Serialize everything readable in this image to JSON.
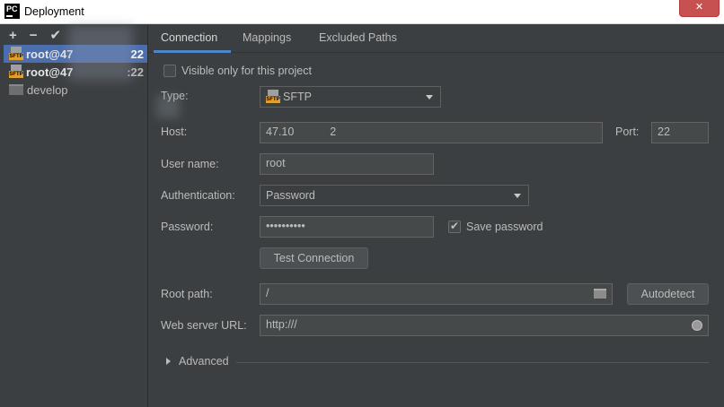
{
  "window": {
    "title": "Deployment",
    "close_label": "✕"
  },
  "left": {
    "toolbar": {
      "add": "+",
      "remove": "−",
      "apply": "✔"
    },
    "servers": [
      {
        "label": "root@47",
        "port_suffix": "22",
        "icon_tag": "SFTP",
        "selected": true
      },
      {
        "label": "root@47",
        "port_suffix": ":22",
        "icon_tag": "SFTP",
        "selected": false
      },
      {
        "label": "develop",
        "selected": false
      }
    ]
  },
  "tabs": [
    {
      "label": "Connection",
      "active": true
    },
    {
      "label": "Mappings",
      "active": false
    },
    {
      "label": "Excluded Paths",
      "active": false
    }
  ],
  "form": {
    "visible_only_label": "Visible only for this project",
    "visible_only_checked": false,
    "type": {
      "label": "Type:",
      "value": "SFTP",
      "icon_tag": "SFTP"
    },
    "host": {
      "label": "Host:",
      "value": "47.10",
      "value_end": "2"
    },
    "port": {
      "label": "Port:",
      "value": "22"
    },
    "username": {
      "label": "User name:",
      "value": "root"
    },
    "authentication": {
      "label": "Authentication:",
      "value": "Password"
    },
    "password": {
      "label": "Password:",
      "value": "••••••••••"
    },
    "save_password": {
      "label": "Save password",
      "checked": true
    },
    "test_connection_label": "Test Connection",
    "root_path": {
      "label": "Root path:",
      "value": "/"
    },
    "autodetect_label": "Autodetect",
    "web_server_url": {
      "label": "Web server URL:",
      "value": "http:///"
    },
    "advanced_label": "Advanced"
  },
  "colors": {
    "accent": "#4a88c7",
    "selection": "#4b6eaf",
    "background": "#3c3f41"
  }
}
